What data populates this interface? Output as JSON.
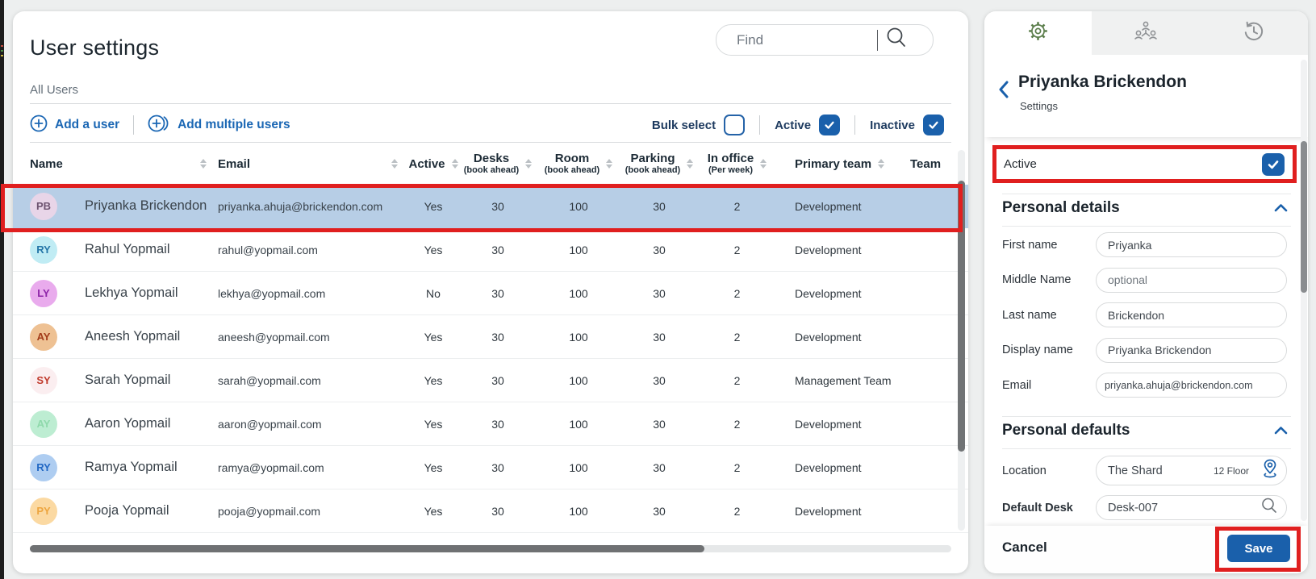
{
  "left_panel": {
    "title": "User settings",
    "view_label": "All Users",
    "search": {
      "placeholder": "Find"
    },
    "toolbar": {
      "add_user": "Add a user",
      "add_multiple": "Add multiple users",
      "bulk_select": "Bulk select",
      "active_filter": "Active",
      "inactive_filter": "Inactive",
      "bulk_select_checked": false,
      "active_checked": true,
      "inactive_checked": true
    },
    "table": {
      "columns": [
        {
          "key": "name",
          "label": "Name",
          "sub": "",
          "sortable": true
        },
        {
          "key": "email",
          "label": "Email",
          "sub": "",
          "sortable": true
        },
        {
          "key": "active",
          "label": "Active",
          "sub": "",
          "sortable": true
        },
        {
          "key": "desks",
          "label": "Desks",
          "sub": "(book ahead)",
          "sortable": true
        },
        {
          "key": "room",
          "label": "Room",
          "sub": "(book ahead)",
          "sortable": true
        },
        {
          "key": "parking",
          "label": "Parking",
          "sub": "(book ahead)",
          "sortable": true
        },
        {
          "key": "in_office",
          "label": "In office",
          "sub": "(Per week)",
          "sortable": true
        },
        {
          "key": "primary_team",
          "label": "Primary team",
          "sub": "",
          "sortable": true
        },
        {
          "key": "team",
          "label": "Team",
          "sub": "",
          "sortable": false
        }
      ],
      "rows": [
        {
          "initials": "PB",
          "name": "Priyanka Brickendon",
          "email": "priyanka.ahuja@brickendon.com",
          "active": "Yes",
          "desks": "30",
          "room": "100",
          "parking": "30",
          "in_office": "2",
          "primary_team": "Development",
          "team": "",
          "avatar_bg": "#e8d5e8",
          "avatar_fg": "#6d5370",
          "selected": true,
          "annotated": true
        },
        {
          "initials": "RY",
          "name": "Rahul Yopmail",
          "email": "rahul@yopmail.com",
          "active": "Yes",
          "desks": "30",
          "room": "100",
          "parking": "30",
          "in_office": "2",
          "primary_team": "Development",
          "team": "",
          "avatar_bg": "#c0ecf4",
          "avatar_fg": "#2476a8",
          "selected": false,
          "annotated": false
        },
        {
          "initials": "LY",
          "name": "Lekhya Yopmail",
          "email": "lekhya@yopmail.com",
          "active": "No",
          "desks": "30",
          "room": "100",
          "parking": "30",
          "in_office": "2",
          "primary_team": "Development",
          "team": "",
          "avatar_bg": "#e9abed",
          "avatar_fg": "#8d24a8",
          "selected": false,
          "annotated": false
        },
        {
          "initials": "AY",
          "name": "Aneesh Yopmail",
          "email": "aneesh@yopmail.com",
          "active": "Yes",
          "desks": "30",
          "room": "100",
          "parking": "30",
          "in_office": "2",
          "primary_team": "Development",
          "team": "",
          "avatar_bg": "#eec193",
          "avatar_fg": "#a23b18",
          "selected": false,
          "annotated": false
        },
        {
          "initials": "SY",
          "name": "Sarah Yopmail",
          "email": "sarah@yopmail.com",
          "active": "Yes",
          "desks": "30",
          "room": "100",
          "parking": "30",
          "in_office": "2",
          "primary_team": "Management Team",
          "team": "",
          "avatar_bg": "#fbeef0",
          "avatar_fg": "#c0392b",
          "selected": false,
          "annotated": false
        },
        {
          "initials": "AY",
          "name": "Aaron Yopmail",
          "email": "aaron@yopmail.com",
          "active": "Yes",
          "desks": "30",
          "room": "100",
          "parking": "30",
          "in_office": "2",
          "primary_team": "Development",
          "team": "",
          "avatar_bg": "#bdedd2",
          "avatar_fg": "#8fd9ab",
          "selected": false,
          "annotated": false
        },
        {
          "initials": "RY",
          "name": "Ramya Yopmail",
          "email": "ramya@yopmail.com",
          "active": "Yes",
          "desks": "30",
          "room": "100",
          "parking": "30",
          "in_office": "2",
          "primary_team": "Development",
          "team": "",
          "avatar_bg": "#aecdf1",
          "avatar_fg": "#2268c4",
          "selected": false,
          "annotated": false
        },
        {
          "initials": "PY",
          "name": "Pooja Yopmail",
          "email": "pooja@yopmail.com",
          "active": "Yes",
          "desks": "30",
          "room": "100",
          "parking": "30",
          "in_office": "2",
          "primary_team": "Development",
          "team": "",
          "avatar_bg": "#fbd9a2",
          "avatar_fg": "#eda53f",
          "selected": false,
          "annotated": false
        }
      ]
    }
  },
  "right_panel": {
    "tabs": [
      {
        "name": "settings",
        "active": true
      },
      {
        "name": "teams",
        "active": false
      },
      {
        "name": "history",
        "active": false
      }
    ],
    "header": {
      "title": "Priyanka Brickendon",
      "subtitle": "Settings"
    },
    "active_toggle": {
      "label": "Active",
      "checked": true
    },
    "sections": {
      "personal_details": "Personal details",
      "personal_defaults": "Personal defaults"
    },
    "fields": [
      {
        "label": "First name",
        "value": "Priyanka",
        "placeholder": ""
      },
      {
        "label": "Middle Name",
        "value": "",
        "placeholder": "optional"
      },
      {
        "label": "Last name",
        "value": "Brickendon",
        "placeholder": ""
      },
      {
        "label": "Display name",
        "value": "Priyanka Brickendon",
        "placeholder": ""
      },
      {
        "label": "Email",
        "value": "priyanka.ahuja@brickendon.com",
        "placeholder": ""
      }
    ],
    "defaults": {
      "location_label": "Location",
      "location_building": "The Shard",
      "location_floor": "12 Floor",
      "desk_label": "Default Desk",
      "desk_value": "Desk-007"
    },
    "footer": {
      "cancel": "Cancel",
      "save": "Save"
    }
  },
  "colors": {
    "accent_blue": "#1a60ab",
    "link_blue": "#1b67b4",
    "annotation_red": "#e01f1f",
    "selected_row": "#b7cee6",
    "tab_icon_green": "#5a7d4a",
    "inactive_icon_gray": "#8f9295"
  }
}
